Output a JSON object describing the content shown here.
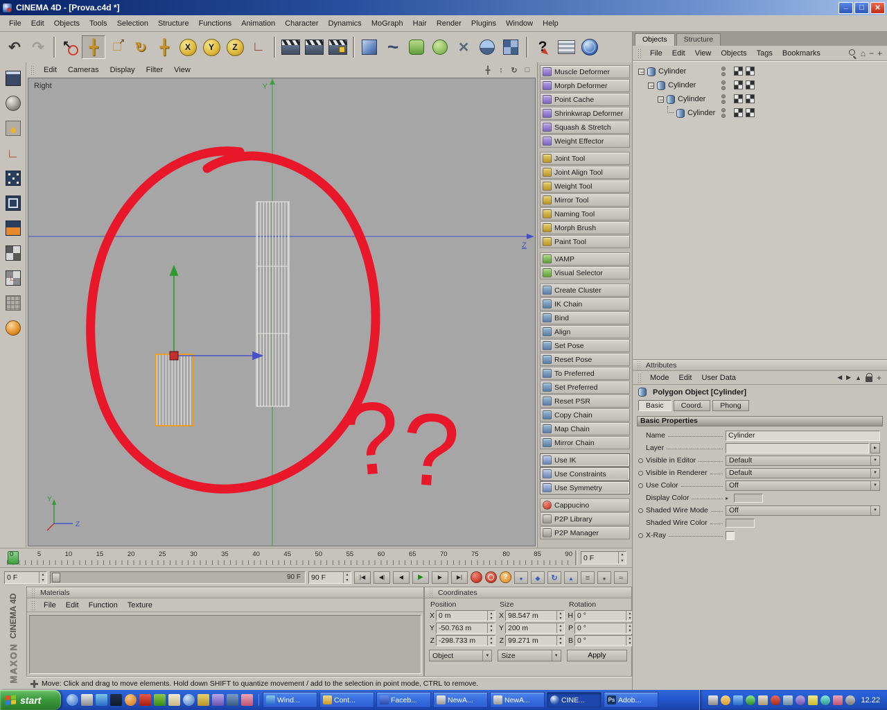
{
  "window": {
    "title": "CINEMA 4D - [Prova.c4d *]"
  },
  "menus": [
    "File",
    "Edit",
    "Objects",
    "Tools",
    "Selection",
    "Structure",
    "Functions",
    "Animation",
    "Character",
    "Dynamics",
    "MoGraph",
    "Hair",
    "Render",
    "Plugins",
    "Window",
    "Help"
  ],
  "toolbar": {
    "axis_x": "X",
    "axis_y": "Y",
    "axis_z": "Z"
  },
  "viewport": {
    "menus": [
      "Edit",
      "Cameras",
      "Display",
      "Filter",
      "View"
    ],
    "view_label": "Right",
    "axis_y_label": "Y",
    "axis_z_label": "Z",
    "origin_labels": {
      "y": "Y",
      "z": "Z"
    },
    "annotation": {
      "q1": "?",
      "q2": "?"
    }
  },
  "character_tools": {
    "group1": [
      "Muscle Deformer",
      "Morph Deformer",
      "Point Cache",
      "Shrinkwrap Deformer",
      "Squash & Stretch",
      "Weight Effector"
    ],
    "group2": [
      "Joint Tool",
      "Joint Align Tool",
      "Weight Tool",
      "Mirror Tool",
      "Naming Tool",
      "Morph Brush",
      "Paint Tool"
    ],
    "group3": [
      "VAMP",
      "Visual Selector"
    ],
    "group4": [
      "Create Cluster",
      "IK Chain",
      "Bind",
      "Align",
      "Set Pose",
      "Reset Pose",
      "To Preferred",
      "Set Preferred",
      "Reset PSR",
      "Copy Chain",
      "Map Chain",
      "Mirror Chain"
    ],
    "group5": [
      "Use IK",
      "Use Constraints",
      "Use Symmetry"
    ],
    "group6": [
      "Cappucino",
      "P2P Library",
      "P2P Manager"
    ]
  },
  "object_manager": {
    "tabs": [
      "Objects",
      "Structure"
    ],
    "menus": [
      "File",
      "Edit",
      "View",
      "Objects",
      "Tags",
      "Bookmarks"
    ],
    "tree": [
      "Cylinder",
      "Cylinder",
      "Cylinder",
      "Cylinder"
    ]
  },
  "attributes": {
    "title": "Attributes",
    "menus": [
      "Mode",
      "Edit",
      "User Data"
    ],
    "object_title": "Polygon Object [Cylinder]",
    "tabs": [
      "Basic",
      "Coord.",
      "Phong"
    ],
    "section_title": "Basic Properties",
    "fields": {
      "name": {
        "label": "Name",
        "value": "Cylinder"
      },
      "layer": {
        "label": "Layer"
      },
      "visible_editor": {
        "label": "Visible in Editor",
        "value": "Default"
      },
      "visible_renderer": {
        "label": "Visible in Renderer",
        "value": "Default"
      },
      "use_color": {
        "label": "Use Color",
        "value": "Off"
      },
      "display_color": {
        "label": "Display Color"
      },
      "shaded_wire_mode": {
        "label": "Shaded Wire Mode",
        "value": "Off"
      },
      "shaded_wire_color": {
        "label": "Shaded Wire Color"
      },
      "xray": {
        "label": "X-Ray"
      }
    }
  },
  "timeline": {
    "ticks": [
      "0",
      "5",
      "10",
      "15",
      "20",
      "25",
      "30",
      "35",
      "40",
      "45",
      "50",
      "55",
      "60",
      "65",
      "70",
      "75",
      "80",
      "85",
      "90"
    ],
    "frame_field": "0 F",
    "range_start": "0 F",
    "slider_end_label": "90 F",
    "range_end": "90 F"
  },
  "materials": {
    "title": "Materials",
    "menus": [
      "File",
      "Edit",
      "Function",
      "Texture"
    ]
  },
  "coordinates": {
    "title": "Coordinates",
    "headers": [
      "Position",
      "Size",
      "Rotation"
    ],
    "position": [
      {
        "axis": "X",
        "value": "0 m"
      },
      {
        "axis": "Y",
        "value": "-50.763 m"
      },
      {
        "axis": "Z",
        "value": "-298.733 m"
      }
    ],
    "size": [
      {
        "axis": "X",
        "value": "98.547 m"
      },
      {
        "axis": "Y",
        "value": "200 m"
      },
      {
        "axis": "Z",
        "value": "99.271 m"
      }
    ],
    "rotation": [
      {
        "axis": "H",
        "value": "0 °"
      },
      {
        "axis": "P",
        "value": "0 °"
      },
      {
        "axis": "B",
        "value": "0 °"
      }
    ],
    "mode_select": "Object",
    "size_select": "Size",
    "apply_label": "Apply"
  },
  "status_bar": {
    "text": "Move: Click and drag to move elements. Hold down SHIFT to quantize movement / add to the selection in point mode, CTRL to remove."
  },
  "branding": {
    "line1": "MAXON",
    "line2": "CINEMA 4D"
  },
  "taskbar": {
    "start_label": "start",
    "tasks": [
      "Wind...",
      "Cont...",
      "Faceb...",
      "NewA...",
      "NewA...",
      "CINE...",
      "Adob..."
    ],
    "clock": "12.22"
  },
  "colors": {
    "annotation": "#e8182a",
    "axis_x": "#c33131",
    "axis_y": "#2f9b2f",
    "axis_z": "#4550c8",
    "selection": "#ff9a00"
  }
}
